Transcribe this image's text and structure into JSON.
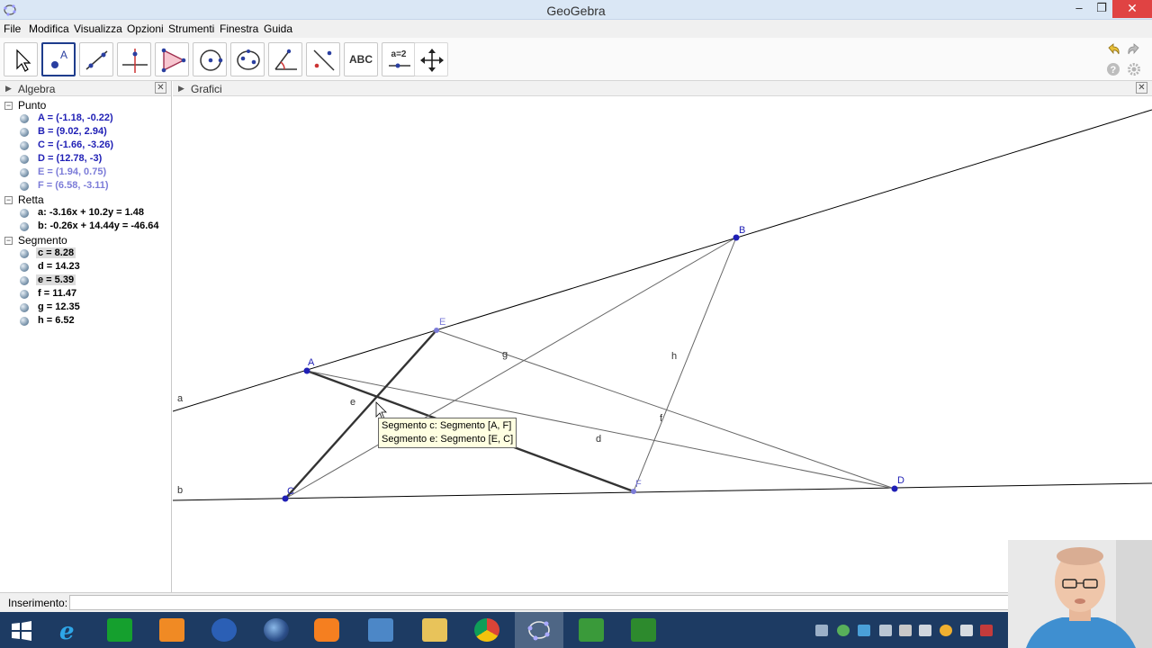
{
  "window": {
    "title": "GeoGebra",
    "minimize": "‒",
    "restore": "❐",
    "close": "✕"
  },
  "menu": [
    "File",
    "Modifica",
    "Visualizza",
    "Opzioni",
    "Strumenti",
    "Finestra",
    "Guida"
  ],
  "toolbar": {
    "tools": [
      {
        "name": "move-tool-button",
        "icon": "arrow-cursor-icon"
      },
      {
        "name": "point-tool-button",
        "icon": "point-a-icon",
        "selected": true
      },
      {
        "name": "line-tool-button",
        "icon": "line-icon"
      },
      {
        "name": "perpendicular-tool-button",
        "icon": "perpendicular-line-icon"
      },
      {
        "name": "polygon-tool-button",
        "icon": "polygon-icon"
      },
      {
        "name": "circle-tool-button",
        "icon": "circle-icon"
      },
      {
        "name": "conic-tool-button",
        "icon": "conic-icon"
      },
      {
        "name": "angle-tool-button",
        "icon": "angle-icon"
      },
      {
        "name": "reflect-tool-button",
        "icon": "reflect-icon"
      },
      {
        "name": "text-tool-button",
        "icon": "text-icon",
        "label": "ABC"
      },
      {
        "name": "slider-tool-button",
        "icon": "slider-icon",
        "label": "a=2"
      },
      {
        "name": "move-view-tool-button",
        "icon": "move-view-icon"
      }
    ]
  },
  "algebra": {
    "title": "Algebra",
    "categories": [
      {
        "label": "Punto",
        "items": [
          {
            "text": "A = (-1.18, -0.22)",
            "color": "#1f1fb5"
          },
          {
            "text": "B = (9.02, 2.94)",
            "color": "#1f1fb5"
          },
          {
            "text": "C = (-1.66, -3.26)",
            "color": "#1f1fb5"
          },
          {
            "text": "D = (12.78, -3)",
            "color": "#1f1fb5"
          },
          {
            "text": "E = (1.94, 0.75)",
            "color": "#7c7cd8"
          },
          {
            "text": "F = (6.58, -3.11)",
            "color": "#7c7cd8"
          }
        ]
      },
      {
        "label": "Retta",
        "items": [
          {
            "text": "a: -3.16x + 10.2y = 1.48",
            "color": "#000000"
          },
          {
            "text": "b: -0.26x + 14.44y = -46.64",
            "color": "#000000"
          }
        ]
      },
      {
        "label": "Segmento",
        "items": [
          {
            "text": "c = 8.28",
            "color": "#000000",
            "highlight": true
          },
          {
            "text": "d = 14.23",
            "color": "#000000"
          },
          {
            "text": "e = 5.39",
            "color": "#000000",
            "highlight": true
          },
          {
            "text": "f = 11.47",
            "color": "#000000"
          },
          {
            "text": "g = 12.35",
            "color": "#000000"
          },
          {
            "text": "h = 6.52",
            "color": "#000000"
          }
        ]
      }
    ]
  },
  "graphics": {
    "title": "Grafici",
    "labels": {
      "A": "A",
      "B": "B",
      "C": "C",
      "D": "D",
      "E": "E",
      "F": "F",
      "a": "a",
      "b": "b",
      "d": "d",
      "e": "e",
      "f": "f",
      "g": "g",
      "h": "h"
    },
    "tooltip": [
      "Segmento c: Segmento [A, F]",
      "Segmento e: Segmento [E, C]"
    ]
  },
  "input": {
    "label": "Inserimento:",
    "value": ""
  },
  "colors": {
    "point": "#1f1fb5",
    "point_light": "#7c7cd8",
    "line": "#000000",
    "segment": "#666666"
  },
  "taskbar": {
    "apps": [
      "windows-start-icon",
      "internet-explorer-icon",
      "store-icon",
      "file-explorer-icon",
      "help-icon",
      "firefox-icon",
      "media-player-icon",
      "paint-icon",
      "folder-icon",
      "chrome-icon",
      "geogebra-icon",
      "camtasia-recorder-icon",
      "camtasia-studio-icon"
    ]
  }
}
